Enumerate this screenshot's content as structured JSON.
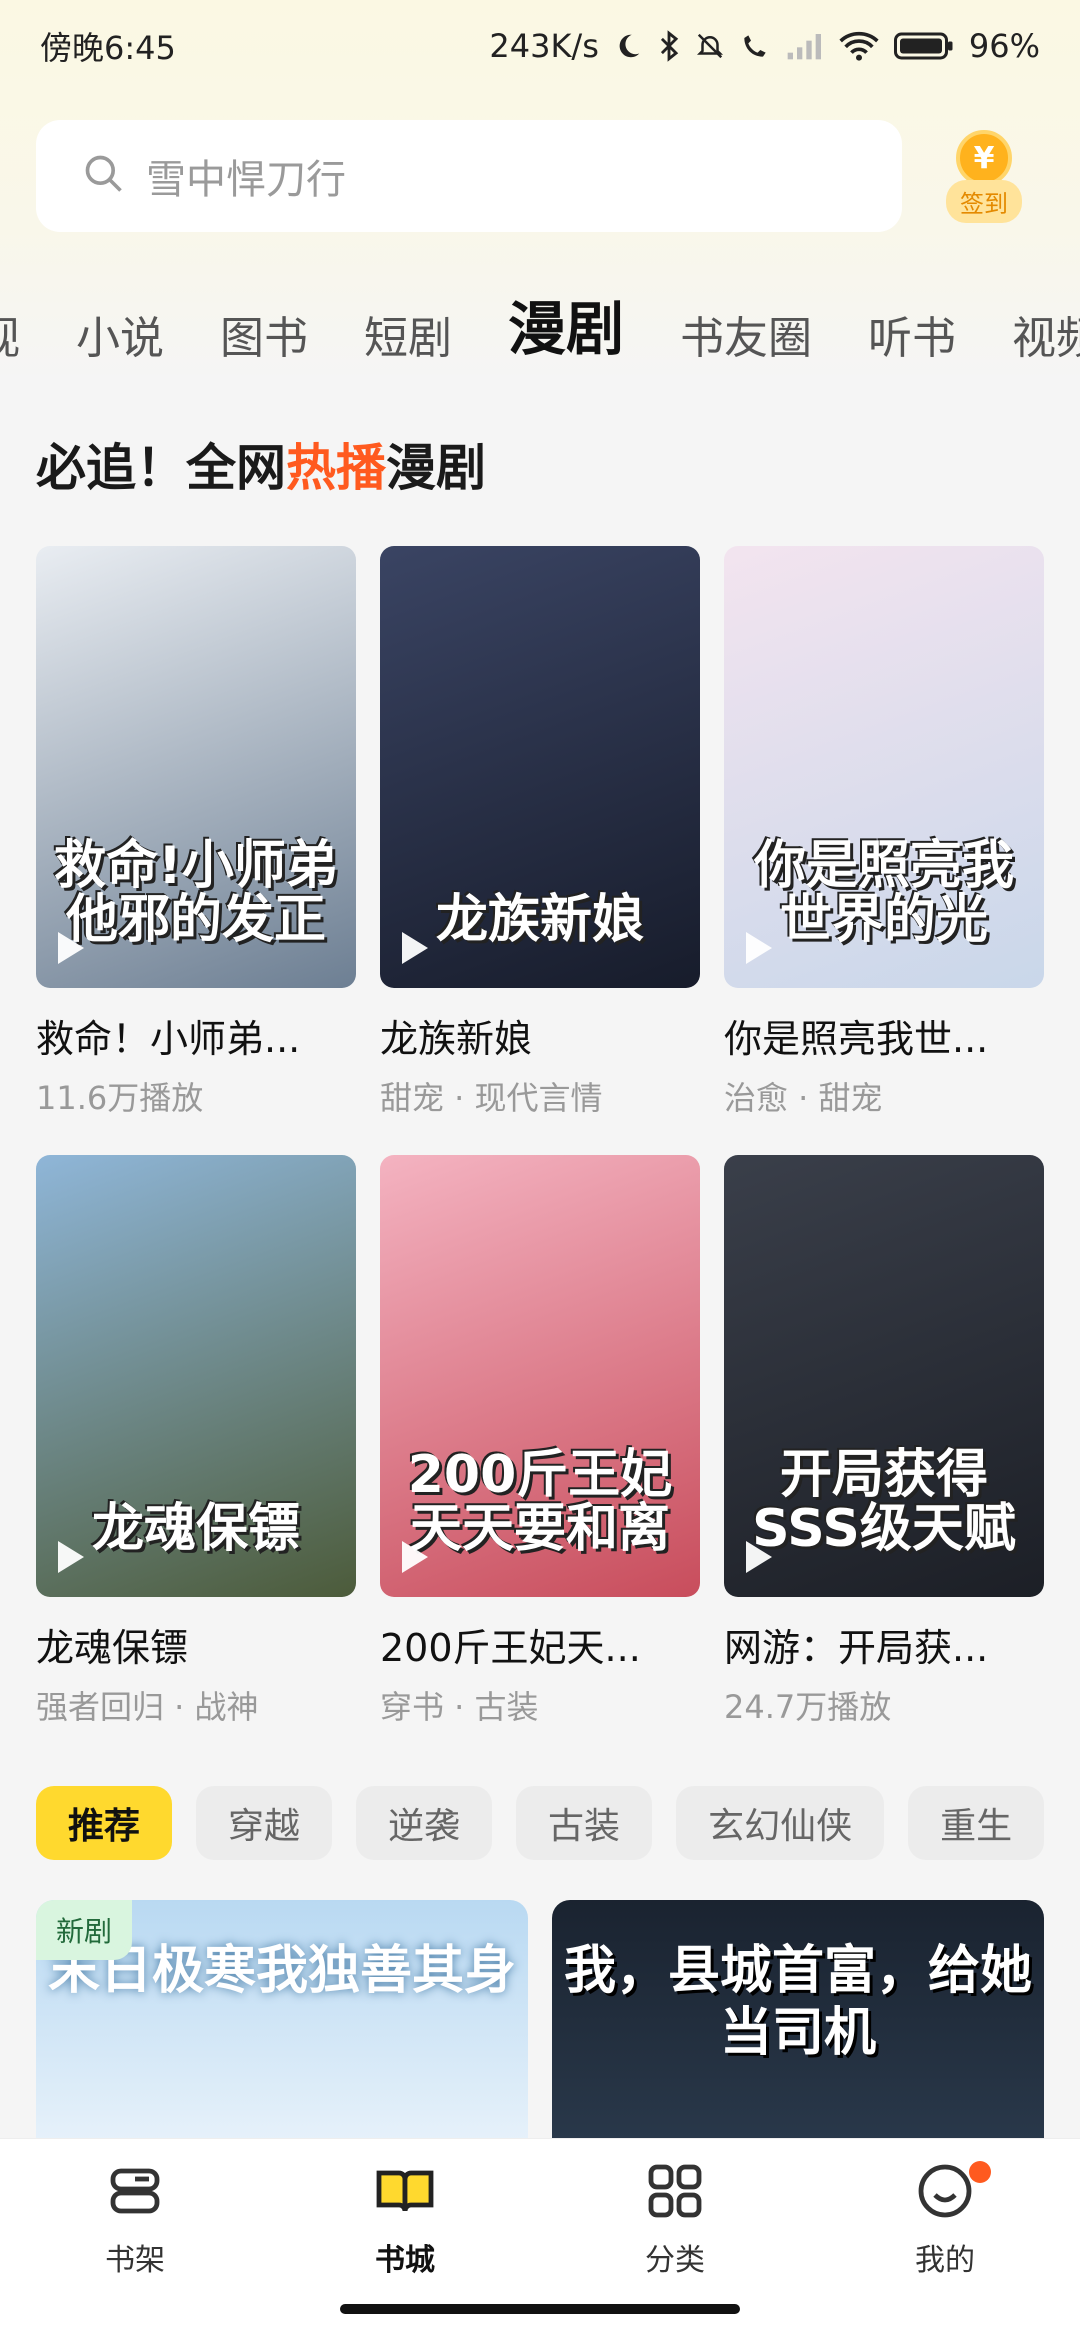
{
  "status_bar": {
    "time": "傍晚6:45",
    "network_speed": "243K/s",
    "battery": "96%"
  },
  "search": {
    "placeholder": "雪中悍刀行"
  },
  "signin": {
    "coin_symbol": "¥",
    "label": "签到"
  },
  "tabs": [
    {
      "label": "视",
      "active": false
    },
    {
      "label": "小说",
      "active": false
    },
    {
      "label": "图书",
      "active": false
    },
    {
      "label": "短剧",
      "active": false
    },
    {
      "label": "漫剧",
      "active": true
    },
    {
      "label": "书友圈",
      "active": false
    },
    {
      "label": "听书",
      "active": false
    },
    {
      "label": "视频",
      "active": false
    }
  ],
  "section": {
    "title_part1": "必追！全网",
    "title_hot": "热播",
    "title_part2": "漫剧"
  },
  "cards": [
    {
      "title": "救命！小师弟...",
      "subtitle": "11.6万播放",
      "cover_text": "救命!小师弟他邪的发正",
      "colors": [
        "#e9edf2",
        "#6d7f93"
      ]
    },
    {
      "title": "龙族新娘",
      "subtitle": "甜宠 · 现代言情",
      "cover_text": "龙族新娘",
      "colors": [
        "#3a4463",
        "#171c2b"
      ]
    },
    {
      "title": "你是照亮我世...",
      "subtitle": "治愈 · 甜宠",
      "cover_text": "你是照亮我世界的光",
      "colors": [
        "#f3e4ef",
        "#c9d7ea"
      ]
    },
    {
      "title": "龙魂保镖",
      "subtitle": "强者回归 · 战神",
      "cover_text": "龙魂保镖",
      "colors": [
        "#8fb6d8",
        "#4c5b3a"
      ]
    },
    {
      "title": "200斤王妃天...",
      "subtitle": "穿书 · 古装",
      "cover_text": "200斤王妃天天要和离",
      "colors": [
        "#f4b3c1",
        "#c84d5c"
      ]
    },
    {
      "title": "网游：开局获...",
      "subtitle": "24.7万播放",
      "cover_text": "开局获得SSS级天赋",
      "colors": [
        "#3a3f4a",
        "#1c1f26"
      ]
    }
  ],
  "chips": [
    {
      "label": "推荐",
      "active": true
    },
    {
      "label": "穿越",
      "active": false
    },
    {
      "label": "逆袭",
      "active": false
    },
    {
      "label": "古装",
      "active": false
    },
    {
      "label": "玄幻仙侠",
      "active": false
    },
    {
      "label": "重生",
      "active": false
    }
  ],
  "features": [
    {
      "badge": "新剧",
      "title": "末日极寒我独善其身"
    },
    {
      "title": "我，县城首富，给她当司机"
    }
  ],
  "bottom_nav": [
    {
      "label": "书架",
      "icon": "bookshelf-icon",
      "active": false
    },
    {
      "label": "书城",
      "icon": "book-open-icon",
      "active": true
    },
    {
      "label": "分类",
      "icon": "grid-icon",
      "active": false
    },
    {
      "label": "我的",
      "icon": "smile-face-icon",
      "active": false
    }
  ]
}
